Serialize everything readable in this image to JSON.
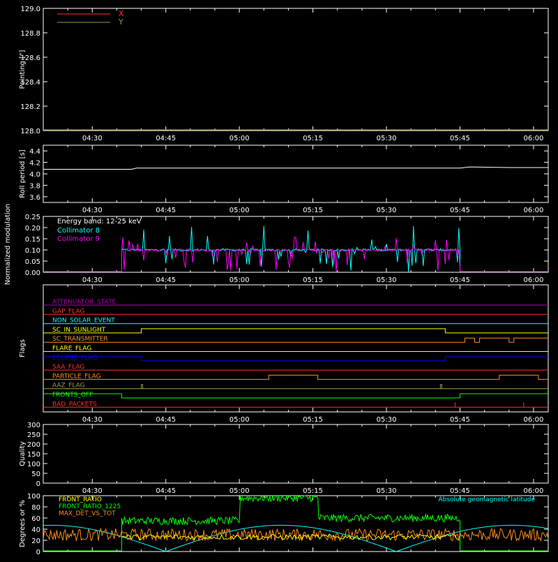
{
  "time_ticks": [
    "04:30",
    "04:45",
    "05:00",
    "05:15",
    "05:30",
    "05:45",
    "06:00"
  ],
  "colors": {
    "white": "#ffffff",
    "red": "#ff3030",
    "yellow": "#ffff00",
    "cyan": "#00ffff",
    "magenta": "#ff00ff",
    "orange": "#ff8c1a",
    "green": "#00ff00",
    "olive": "#9a9a3a",
    "blue": "#0000ff",
    "purple": "#b000b0"
  },
  "chart_data": [
    {
      "id": "pointing",
      "type": "line",
      "ylabel": "Pointing [\"]",
      "ylim": [
        128.0,
        129.0
      ],
      "yticks": [
        "128.0",
        "128.2",
        "128.4",
        "128.6",
        "128.8",
        "129.0"
      ],
      "legend": [
        {
          "name": "X",
          "color": "#ff3030"
        },
        {
          "name": "Y",
          "color": "#9a9a3a"
        }
      ],
      "series": []
    },
    {
      "id": "roll",
      "type": "line",
      "ylabel": "Roll period [s]",
      "ylim": [
        3.5,
        4.5
      ],
      "yticks": [
        "3.6",
        "3.8",
        "4.0",
        "4.2",
        "4.4"
      ],
      "series": [
        {
          "color": "#ffffff",
          "x": [
            "04:20",
            "04:38",
            "04:39",
            "05:45",
            "05:47",
            "05:55",
            "06:03"
          ],
          "y": [
            4.08,
            4.08,
            4.1,
            4.1,
            4.12,
            4.11,
            4.11
          ]
        }
      ]
    },
    {
      "id": "modulation",
      "type": "line",
      "ylabel": "Normalized modulation",
      "ylim": [
        0.0,
        0.25
      ],
      "yticks": [
        "0.00",
        "0.05",
        "0.10",
        "0.15",
        "0.20",
        "0.25"
      ],
      "annotation": "Energy band: 12-25 keV",
      "legend": [
        {
          "name": "Collimator 8",
          "color": "#00ffff"
        },
        {
          "name": "Collimator 9",
          "color": "#ff00ff"
        }
      ],
      "active_range": [
        "04:36",
        "05:45"
      ],
      "base_level": 0.1
    },
    {
      "id": "flags",
      "type": "line",
      "ylabel": "Flags",
      "flags": [
        {
          "name": "ATTENUATOR_STATE",
          "color": "#b000b0",
          "segments": [
            [
              "04:20",
              "06:03",
              0
            ]
          ]
        },
        {
          "name": "GAP_FLAG",
          "color": "#ff3030",
          "segments": [
            [
              "04:20",
              "06:03",
              0
            ]
          ]
        },
        {
          "name": "NON_SOLAR_EVENT",
          "color": "#00ffff",
          "segments": [
            [
              "04:20",
              "06:03",
              0
            ]
          ]
        },
        {
          "name": "SC_IN_SUNLIGHT",
          "color": "#ffff00",
          "segments": [
            [
              "04:20",
              "04:40",
              0
            ],
            [
              "04:40",
              "05:42",
              1
            ],
            [
              "05:42",
              "06:03",
              0
            ]
          ]
        },
        {
          "name": "SC_TRANSMITTER",
          "color": "#ff8c1a",
          "segments": [
            [
              "04:20",
              "05:46",
              0
            ],
            [
              "05:46",
              "05:48",
              1
            ],
            [
              "05:48",
              "05:49",
              0
            ],
            [
              "05:49",
              "05:55",
              1
            ],
            [
              "05:55",
              "05:56",
              0
            ],
            [
              "05:56",
              "06:03",
              1
            ]
          ]
        },
        {
          "name": "FLARE_FLAG",
          "color": "#ffff00",
          "segments": [
            [
              "04:20",
              "06:03",
              0
            ]
          ]
        },
        {
          "name": "ECLIPSE_FLAG",
          "color": "#0000ff",
          "segments": [
            [
              "04:20",
              "04:40",
              1
            ],
            [
              "04:40",
              "05:42",
              0
            ],
            [
              "05:42",
              "06:03",
              1
            ]
          ]
        },
        {
          "name": "SAA_FLAG",
          "color": "#ff3030",
          "segments": [
            [
              "04:20",
              "06:03",
              0
            ]
          ]
        },
        {
          "name": "PARTICLE_FLAG",
          "color": "#ff8c1a",
          "segments": [
            [
              "04:20",
              "05:06",
              0
            ],
            [
              "05:06",
              "05:07",
              1
            ],
            [
              "05:07",
              "05:16",
              1
            ],
            [
              "05:16",
              "05:53",
              0
            ],
            [
              "05:53",
              "06:01",
              1
            ],
            [
              "06:01",
              "06:03",
              0
            ]
          ]
        },
        {
          "name": "AAZ_FLAG",
          "color": "#9a9a3a",
          "segments": [
            [
              "04:20",
              "06:03",
              0
            ]
          ]
        },
        {
          "name": "FRONTS_OFF",
          "color": "#00ff00",
          "segments": [
            [
              "04:20",
              "04:36",
              1
            ],
            [
              "04:36",
              "05:45",
              0
            ],
            [
              "05:45",
              "06:03",
              1
            ]
          ]
        },
        {
          "name": "BAD_PACKETS",
          "color": "#ff3030",
          "segments": [
            [
              "04:20",
              "06:03",
              0
            ]
          ]
        }
      ]
    },
    {
      "id": "quality",
      "type": "line",
      "ylabel": "Quality",
      "ylim": [
        0,
        300
      ],
      "yticks": [
        "0",
        "50",
        "100",
        "150",
        "200",
        "250",
        "300"
      ],
      "series": [
        {
          "color": "#ffffff",
          "x": [
            "04:20",
            "06:03"
          ],
          "y": [
            0,
            0
          ]
        }
      ]
    },
    {
      "id": "ratios",
      "type": "line",
      "ylabel": "Degrees or %",
      "ylim": [
        0,
        100
      ],
      "yticks": [
        "0",
        "20",
        "40",
        "60",
        "80",
        "100"
      ],
      "legend": [
        {
          "name": "FRONT_RATIO",
          "color": "#ffff00"
        },
        {
          "name": "FRONT_RATIO_1225",
          "color": "#00ff00"
        },
        {
          "name": "MAX_DET_VS_TOT",
          "color": "#ff8c1a"
        }
      ],
      "right_legend": {
        "name": "Absolute geomagnetic latitude",
        "color": "#00ffff"
      }
    }
  ]
}
